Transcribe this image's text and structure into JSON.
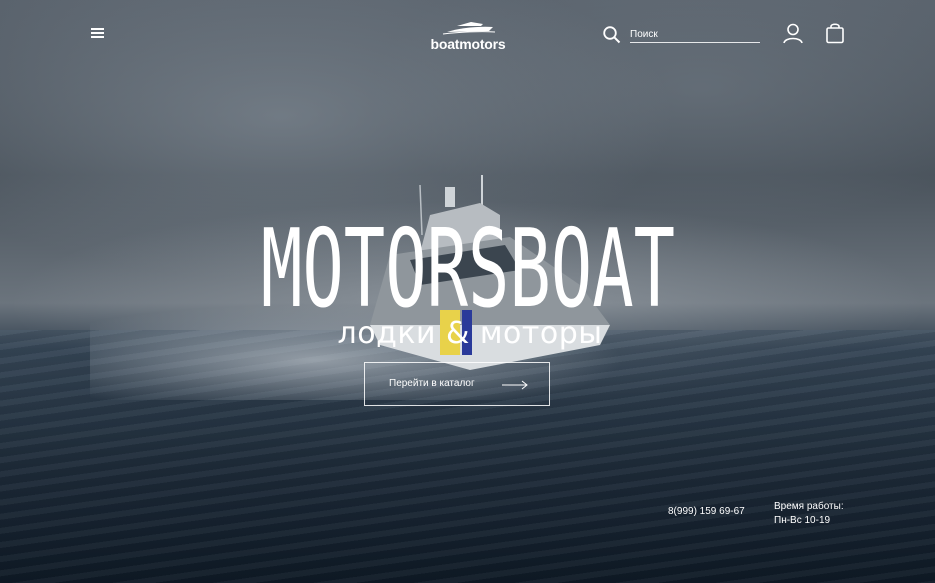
{
  "header": {
    "logo_text": "boatmotors",
    "search": {
      "placeholder": "Поиск"
    }
  },
  "hero": {
    "title": "MOTORSBOAT",
    "subtitle": "лодки & моторы",
    "cta_label": "Перейти в каталог"
  },
  "contacts": {
    "phone": "8(999) 159 69-67",
    "hours_label": "Время работы:",
    "hours_value": "Пн-Вс 10-19"
  },
  "icons": [
    "menu-icon",
    "logo-boat-icon",
    "search-icon",
    "user-icon",
    "shopping-bag-icon",
    "arrow-right-icon"
  ],
  "colors": {
    "text": "#ffffff",
    "sky": "#5a636d",
    "sea": "#1f2c3a"
  }
}
